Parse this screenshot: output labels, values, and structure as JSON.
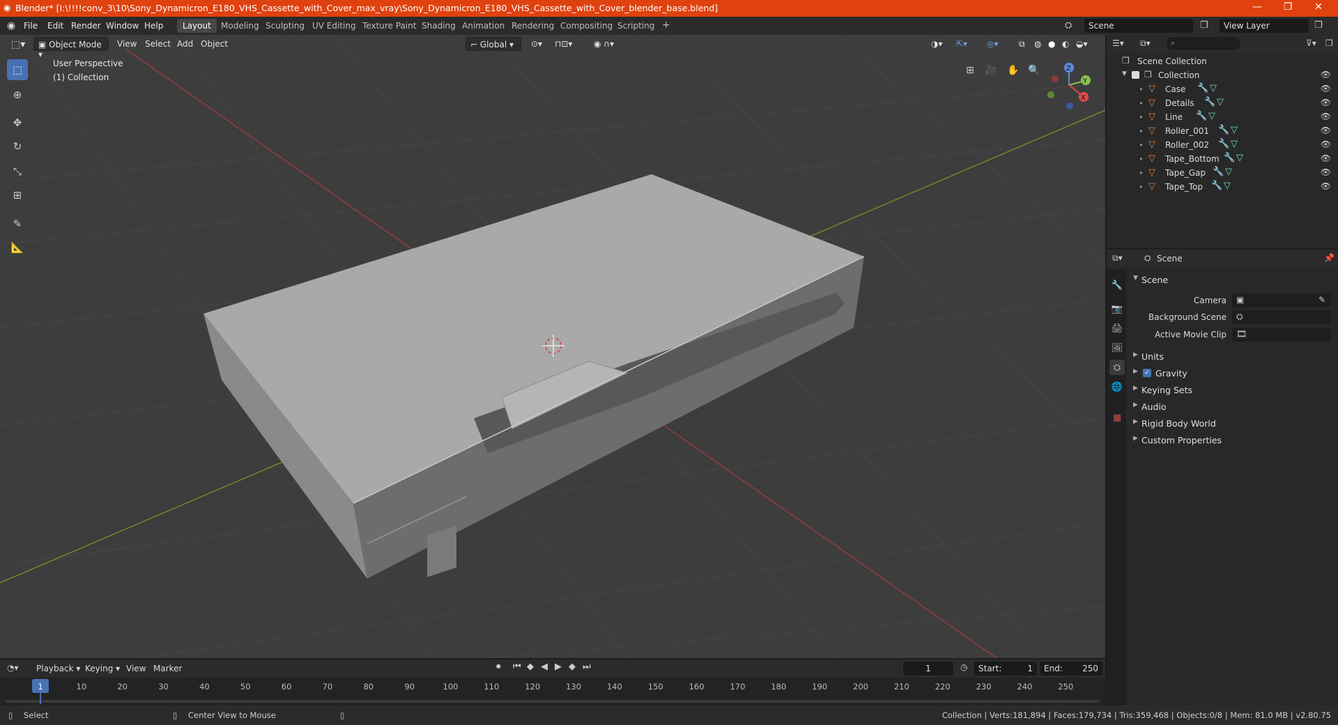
{
  "window": {
    "title": "Blender* [I:\\!!!!conv_3\\10\\Sony_Dynamicron_E180_VHS_Cassette_with_Cover_max_vray\\Sony_Dynamicron_E180_VHS_Cassette_with_Cover_blender_base.blend]",
    "minimize": "—",
    "maximize": "❐",
    "close": "✕"
  },
  "menu": [
    "File",
    "Edit",
    "Render",
    "Window",
    "Help"
  ],
  "workspaces": [
    "Layout",
    "Modeling",
    "Sculpting",
    "UV Editing",
    "Texture Paint",
    "Shading",
    "Animation",
    "Rendering",
    "Compositing",
    "Scripting"
  ],
  "add_workspace": "+",
  "scene_field": "Scene",
  "view_layer_field": "View Layer",
  "viewport": {
    "mode": "Object Mode",
    "menus": [
      "View",
      "Select",
      "Add",
      "Object"
    ],
    "transform_orientation": "Global",
    "overlay_title": "User Perspective",
    "overlay_collection": "(1) Collection",
    "gizmo": {
      "z": "Z",
      "y": "Y",
      "x": "X"
    }
  },
  "outliner": {
    "root": "Scene Collection",
    "collection": "Collection",
    "objects": [
      "Case",
      "Details",
      "Line",
      "Roller_001",
      "Roller_002",
      "Tape_Bottom",
      "Tape_Gap",
      "Tape_Top"
    ]
  },
  "properties": {
    "header": "Scene",
    "panel": "Scene",
    "camera_label": "Camera",
    "background_label": "Background Scene",
    "movieclip_label": "Active Movie Clip",
    "sections": [
      "Units",
      "Gravity",
      "Keying Sets",
      "Audio",
      "Rigid Body World",
      "Custom Properties"
    ],
    "gravity_checked": true
  },
  "timeline": {
    "menus": [
      "Playback",
      "Keying",
      "View",
      "Marker"
    ],
    "current_frame": "1",
    "start_label": "Start:",
    "start": "1",
    "end_label": "End:",
    "end": "250",
    "ticks": [
      "1",
      "10",
      "20",
      "30",
      "40",
      "50",
      "60",
      "70",
      "80",
      "90",
      "100",
      "110",
      "120",
      "130",
      "140",
      "150",
      "160",
      "170",
      "180",
      "190",
      "200",
      "210",
      "220",
      "230",
      "240",
      "250"
    ]
  },
  "status": {
    "select": "Select",
    "center": "Center View to Mouse",
    "stats": "Collection | Verts:181,894 | Faces:179,734 | Tris:359,468 | Objects:0/8 | Mem: 81.0 MB | v2.80.75"
  }
}
